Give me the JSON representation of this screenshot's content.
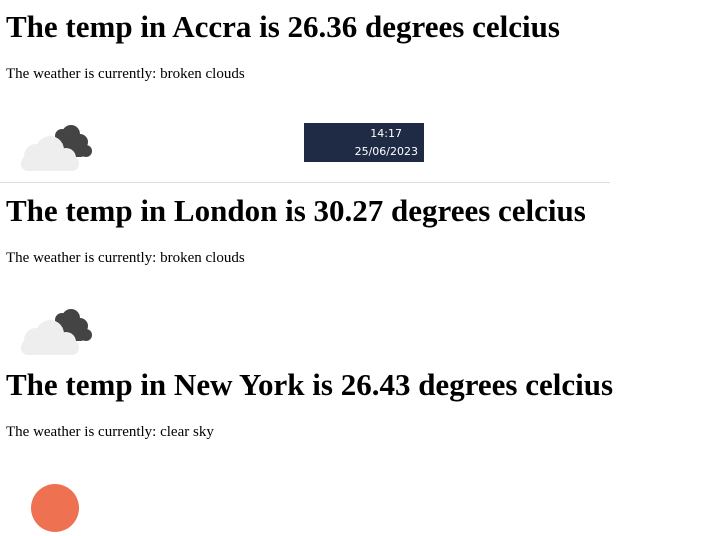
{
  "cities": [
    {
      "heading": "The temp in Accra is 26.36 degrees celcius",
      "description": "The weather is currently: broken clouds",
      "icon": "broken-clouds-icon"
    },
    {
      "heading": "The temp in London is 30.27 degrees celcius",
      "description": "The weather is currently: broken clouds",
      "icon": "broken-clouds-icon"
    },
    {
      "heading": "The temp in New York is 26.43 degrees celcius",
      "description": "The weather is currently: clear sky",
      "icon": "clear-sky-sun-icon"
    }
  ],
  "taskbar_clock": {
    "time": "14:17",
    "date": "25/06/2023"
  },
  "colors": {
    "sun": "#ee7151",
    "cloud_light": "#eeeeee",
    "cloud_dark": "#444444",
    "clock_background": "#1f2b45"
  }
}
